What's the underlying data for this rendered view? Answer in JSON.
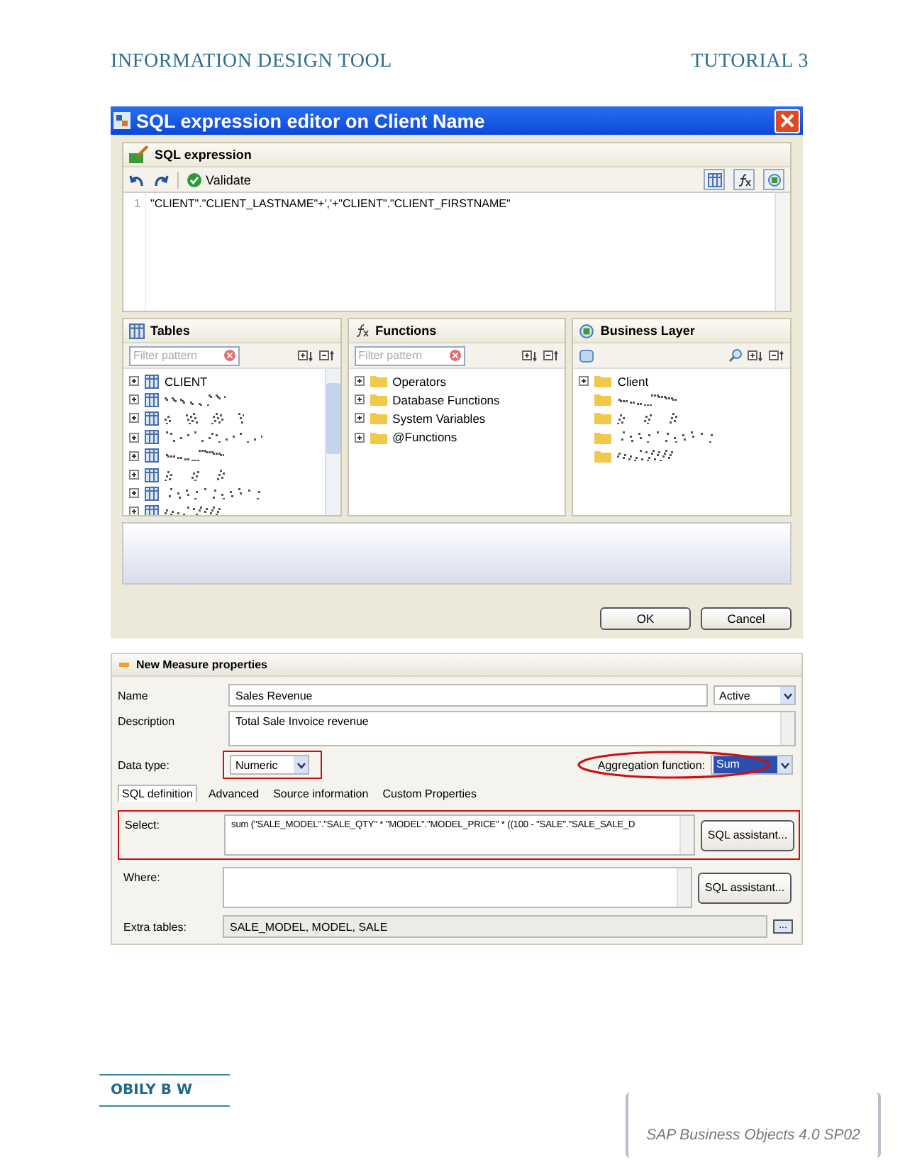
{
  "page_header": {
    "title": "INFORMATION DESIGN TOOL",
    "section": "TUTORIAL 3"
  },
  "dialog": {
    "title": "SQL expression editor on Client Name",
    "expression_panel": {
      "title": "SQL expression",
      "validate": "Validate",
      "line_number": "1",
      "code": "\"CLIENT\".\"CLIENT_LASTNAME\"+','+\"CLIENT\".\"CLIENT_FIRSTNAME\""
    },
    "tables": {
      "title": "Tables",
      "placeholder": "Filter pattern",
      "items": [
        {
          "kind": "named",
          "label": "CLIENT"
        },
        {
          "kind": "obscured"
        },
        {
          "kind": "obscured"
        },
        {
          "kind": "obscured"
        },
        {
          "kind": "obscured"
        },
        {
          "kind": "obscured"
        },
        {
          "kind": "obscured"
        },
        {
          "kind": "obscured"
        }
      ]
    },
    "functions": {
      "title": "Functions",
      "placeholder": "Filter pattern",
      "items": [
        "Operators",
        "Database Functions",
        "System Variables",
        "@Functions"
      ]
    },
    "business_layer": {
      "title": "Business Layer",
      "items": [
        {
          "kind": "named",
          "label": "Client"
        },
        {
          "kind": "obscured"
        },
        {
          "kind": "obscured"
        },
        {
          "kind": "obscured"
        },
        {
          "kind": "obscured"
        }
      ]
    },
    "buttons": [
      "OK",
      "Cancel"
    ]
  },
  "measure": {
    "title": "New Measure properties",
    "name_label": "Name",
    "name": "Sales Revenue",
    "state": "Active",
    "description_label": "Description",
    "description": "Total Sale Invoice revenue",
    "data_type_label": "Data type:",
    "data_type": "Numeric",
    "aggregation_label": "Aggregation function:",
    "aggregation": "Sum",
    "tabs": [
      {
        "label": "SQL definition",
        "selected": true
      },
      {
        "label": "Advanced",
        "selected": false
      },
      {
        "label": "Source information",
        "selected": false
      },
      {
        "label": "Custom Properties",
        "selected": false
      }
    ],
    "select_label": "Select:",
    "select": "sum (\"SALE_MODEL\".\"SALE_QTY\" * \"MODEL\".\"MODEL_PRICE\" * ((100 - \"SALE\".\"SALE_SALE_D",
    "where_label": "Where:",
    "assistant_buttons": [
      "SQL assistant...",
      "SQL assistant..."
    ],
    "extra_tables_label": "Extra tables:",
    "extra_tables": "SALE_MODEL, MODEL, SALE",
    "browse": "..."
  },
  "footer": {
    "author": "OBILY B W",
    "product": "SAP Business Objects 4.0 SP02"
  }
}
